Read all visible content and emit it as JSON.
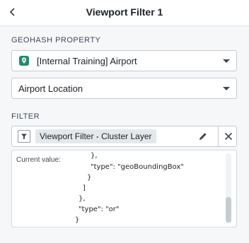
{
  "header": {
    "title": "Viewport Filter 1",
    "back_icon": "chevron-left-icon"
  },
  "geohash": {
    "label": "GEOHASH PROPERTY",
    "object_type": "[Internal Training] Airport",
    "object_type_icon": "map-pin-icon",
    "object_type_icon_color": "#238c6a",
    "property": "Airport Location"
  },
  "filter": {
    "label": "FILTER",
    "icon": "filter-icon",
    "tag": "Viewport Filter - Cluster Layer",
    "edit_icon": "pencil-icon",
    "clear_icon": "close-icon",
    "current_value_label": "Current value:",
    "code_lines": [
      "},",
      "\"type\": \"geoBoundingBox\"",
      "}",
      "]",
      "},",
      "\"type\": \"or\"",
      "}"
    ]
  }
}
